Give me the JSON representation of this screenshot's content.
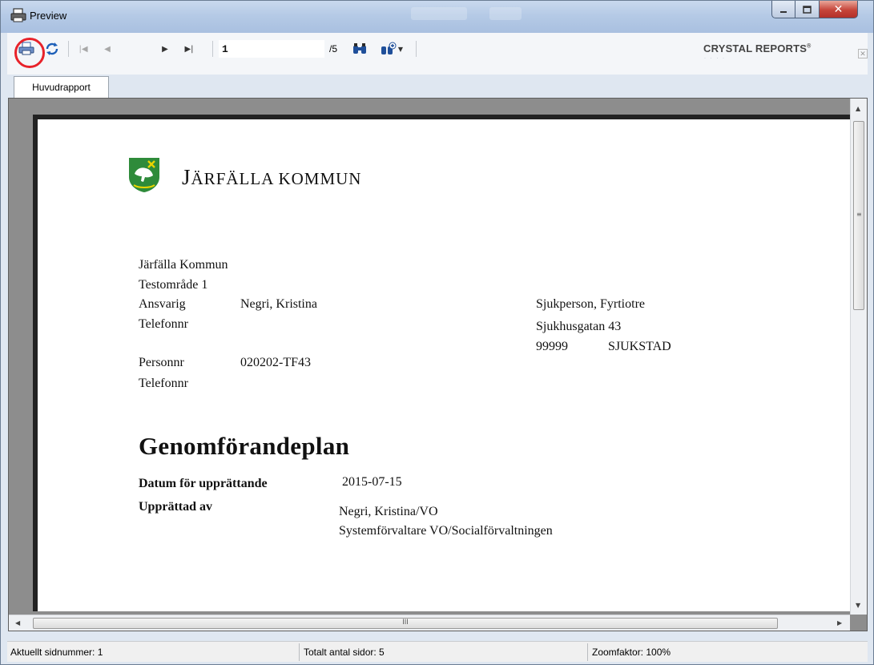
{
  "window": {
    "title": "Preview"
  },
  "toolbar": {
    "page_value": "1",
    "page_total": "/5",
    "brand": "CRYSTAL REPORTS",
    "brand_mark": "®"
  },
  "tabs": [
    {
      "label": "Huvudrapport"
    }
  ],
  "document": {
    "org_prefix": "J",
    "org_rest": "ÄRFÄLLA KOMMUN",
    "sender": {
      "line1": "Järfälla Kommun",
      "line2": "Testområde 1",
      "ansvarig_label": "Ansvarig",
      "ansvarig_value": "Negri, Kristina",
      "telefon_label": "Telefonnr"
    },
    "recipient": {
      "name": "Sjukperson, Fyrtiotre",
      "street": "Sjukhusgatan 43",
      "postcode": "99999",
      "city": "SJUKSTAD"
    },
    "person": {
      "personnr_label": "Personnr",
      "personnr_value": "020202-TF43",
      "telefon_label": "Telefonnr"
    },
    "heading": "Genomförandeplan",
    "fields": {
      "date_label": "Datum för upprättande",
      "date_value": "2015-07-15",
      "by_label": "Upprättad av",
      "by_value1": "Negri, Kristina/VO",
      "by_value2": "Systemförvaltare VO/Socialförvaltningen"
    }
  },
  "hscroll_grip": "III",
  "statusbar": {
    "current_page": "Aktuellt sidnummer: 1",
    "total_pages": "Totalt antal sidor: 5",
    "zoom": "Zoomfaktor: 100%"
  },
  "colors": {
    "highlight": "#e8222a",
    "logo_green": "#2e8b3a",
    "close_red": "#c6453a"
  }
}
